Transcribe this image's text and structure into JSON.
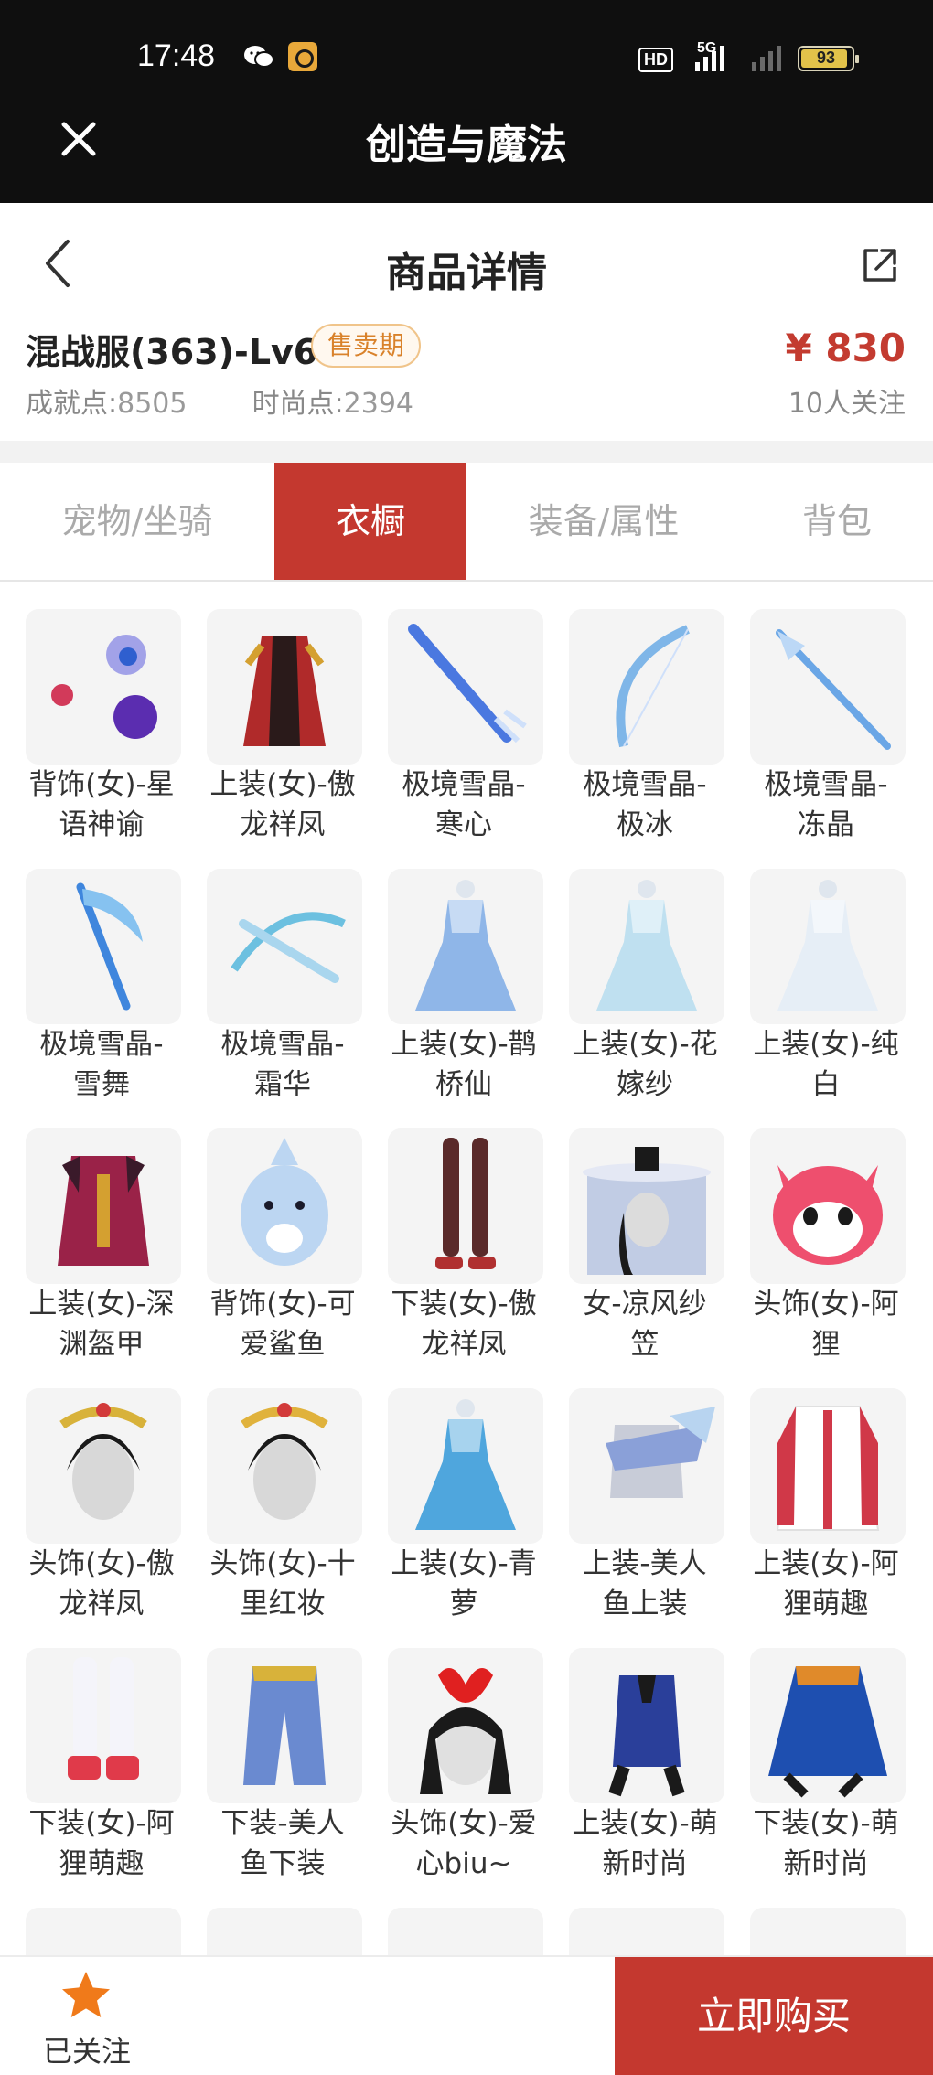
{
  "status_bar": {
    "time": "17:48",
    "network": "5G",
    "battery": "93",
    "battery_level": 0.93
  },
  "top_bar": {
    "title": "创造与魔法",
    "close_icon": "close-icon"
  },
  "nav_bar": {
    "title": "商品详情",
    "back_icon": "chevron-left-icon",
    "share_icon": "share-icon"
  },
  "product": {
    "name": "混战服(363)-Lv69",
    "badge": "售卖期",
    "price": "¥ 830",
    "achievement_label": "成就点:",
    "achievement_value": "8505",
    "fashion_label": "时尚点:",
    "fashion_value": "2394",
    "followers": "10人关注"
  },
  "tabs": [
    {
      "label": "宠物/坐骑",
      "active": false
    },
    {
      "label": "衣橱",
      "active": true
    },
    {
      "label": "装备/属性",
      "active": false
    },
    {
      "label": "背包",
      "active": false
    }
  ],
  "items": [
    {
      "line1": "背饰(女)-星",
      "line2": "语神谕",
      "icon": "orb-icon",
      "color": "#6b6be0"
    },
    {
      "line1": "上装(女)-傲",
      "line2": "龙祥凤",
      "icon": "robe-icon",
      "color": "#b02a2a"
    },
    {
      "line1": "极境雪晶-",
      "line2": "寒心",
      "icon": "sword-icon",
      "color": "#4a78e0"
    },
    {
      "line1": "极境雪晶-",
      "line2": "极冰",
      "icon": "bow-icon",
      "color": "#7fb6e8"
    },
    {
      "line1": "极境雪晶-",
      "line2": "冻晶",
      "icon": "spear-icon",
      "color": "#6aa6e6"
    },
    {
      "line1": "极境雪晶-",
      "line2": "雪舞",
      "icon": "scythe-icon",
      "color": "#3f86dd"
    },
    {
      "line1": "极境雪晶-",
      "line2": "霜华",
      "icon": "crossbow-icon",
      "color": "#6cc0e0"
    },
    {
      "line1": "上装(女)-鹊",
      "line2": "桥仙",
      "icon": "dress-icon",
      "color": "#8fb6e8"
    },
    {
      "line1": "上装(女)-花",
      "line2": "嫁纱",
      "icon": "dress-icon",
      "color": "#bfe0f0"
    },
    {
      "line1": "上装(女)-纯",
      "line2": "白",
      "icon": "dress-icon",
      "color": "#e6eef6"
    },
    {
      "line1": "上装(女)-深",
      "line2": "渊盔甲",
      "icon": "armor-icon",
      "color": "#9a2248"
    },
    {
      "line1": "背饰(女)-可",
      "line2": "爱鲨鱼",
      "icon": "shark-icon",
      "color": "#bcd6f2"
    },
    {
      "line1": "下装(女)-傲",
      "line2": "龙祥凤",
      "icon": "legs-icon",
      "color": "#5a2a2a"
    },
    {
      "line1": "女-凉风纱",
      "line2": "笠",
      "icon": "hat-icon",
      "color": "#9fb0d8"
    },
    {
      "line1": "头饰(女)-阿",
      "line2": "狸",
      "icon": "fox-head-icon",
      "color": "#ee4f6e"
    },
    {
      "line1": "头饰(女)-傲",
      "line2": "龙祥凤",
      "icon": "headdress-icon",
      "color": "#d8b23a"
    },
    {
      "line1": "头饰(女)-十",
      "line2": "里红妆",
      "icon": "headdress-icon",
      "color": "#e0b23c"
    },
    {
      "line1": "上装(女)-青",
      "line2": "萝",
      "icon": "dress-icon",
      "color": "#4fa6dd"
    },
    {
      "line1": "上装-美人",
      "line2": "鱼上装",
      "icon": "top-icon",
      "color": "#8aa0d8"
    },
    {
      "line1": "上装(女)-阿",
      "line2": "狸萌趣",
      "icon": "jacket-icon",
      "color": "#d03848"
    },
    {
      "line1": "下装(女)-阿",
      "line2": "狸萌趣",
      "icon": "boots-icon",
      "color": "#e03a4a"
    },
    {
      "line1": "下装-美人",
      "line2": "鱼下装",
      "icon": "pants-icon",
      "color": "#6a8ad0"
    },
    {
      "line1": "头饰(女)-爱",
      "line2": "心biu~",
      "icon": "heart-headband-icon",
      "color": "#e02020"
    },
    {
      "line1": "上装(女)-萌",
      "line2": "新时尚",
      "icon": "vest-icon",
      "color": "#2a3f9a"
    },
    {
      "line1": "下装(女)-萌",
      "line2": "新时尚",
      "icon": "skirt-icon",
      "color": "#1e4fb0"
    },
    {
      "line1": "",
      "line2": "",
      "icon": "partial-icon",
      "color": "#c8ccd8"
    },
    {
      "line1": "",
      "line2": "",
      "icon": "partial-icon",
      "color": "#f0a0c8"
    },
    {
      "line1": "",
      "line2": "",
      "icon": "partial-icon",
      "color": "#e870a8"
    },
    {
      "line1": "",
      "line2": "",
      "icon": "partial-icon",
      "color": "#2f5fcf"
    },
    {
      "line1": "",
      "line2": "",
      "icon": "partial-icon",
      "color": "#c8dcf0"
    }
  ],
  "bottom_bar": {
    "follow_label": "已关注",
    "buy_label": "立即购买",
    "star_icon": "star-icon",
    "star_color": "#f07a1a"
  },
  "colors": {
    "accent": "#c4382f",
    "badge": "#d9822b",
    "topbar": "#0f0f0f"
  }
}
